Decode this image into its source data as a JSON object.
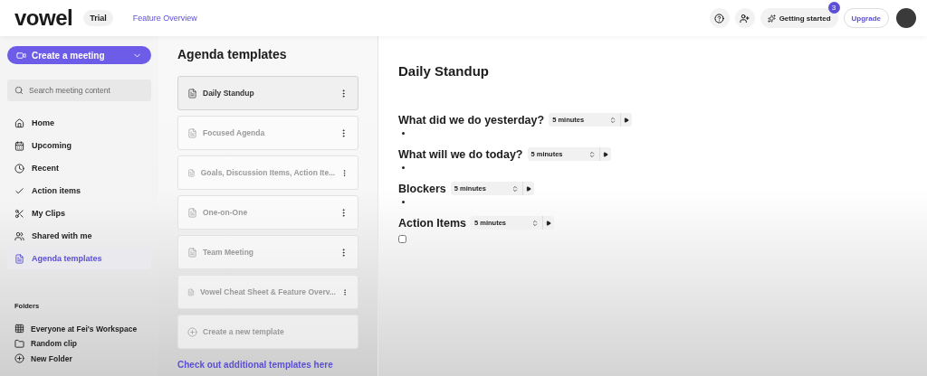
{
  "header": {
    "logo": "vowel",
    "plan_badge": "Trial",
    "feature_link": "Feature Overview",
    "getting_started": {
      "label": "Getting started",
      "count": "3"
    },
    "upgrade": "Upgrade"
  },
  "sidebar": {
    "create_button": "Create a meeting",
    "search": {
      "placeholder": "Search meeting content"
    },
    "items": [
      {
        "label": "Home",
        "selected": false
      },
      {
        "label": "Upcoming",
        "selected": false
      },
      {
        "label": "Recent",
        "selected": false
      },
      {
        "label": "Action items",
        "selected": false
      },
      {
        "label": "My Clips",
        "selected": false
      },
      {
        "label": "Shared with me",
        "selected": false
      },
      {
        "label": "Agenda templates",
        "selected": true
      }
    ],
    "folders_heading": "Folders",
    "folders": [
      {
        "label": "Everyone at Fei's Workspace"
      },
      {
        "label": "Random clip"
      },
      {
        "label": "New Folder"
      }
    ]
  },
  "templates": {
    "title": "Agenda templates",
    "items": [
      {
        "name": "Daily Standup",
        "selected": true
      },
      {
        "name": "Focused Agenda",
        "selected": false
      },
      {
        "name": "Goals, Discussion Items, Action Ite...",
        "selected": false
      },
      {
        "name": "One-on-One",
        "selected": false
      },
      {
        "name": "Team Meeting",
        "selected": false
      },
      {
        "name": "Vowel Cheat Sheet & Feature Overv...",
        "selected": false
      }
    ],
    "create_label": "Create a new template",
    "more_link": "Check out additional templates here"
  },
  "agenda": {
    "title": "Daily Standup",
    "sections": [
      {
        "heading": "What did we do yesterday?",
        "duration": "5 minutes",
        "kind": "bullet"
      },
      {
        "heading": "What will we do today?",
        "duration": "5 minutes",
        "kind": "bullet"
      },
      {
        "heading": "Blockers",
        "duration": "5 minutes",
        "kind": "bullet"
      },
      {
        "heading": "Action Items",
        "duration": "5 minutes",
        "kind": "checkbox",
        "checked": false
      }
    ]
  }
}
